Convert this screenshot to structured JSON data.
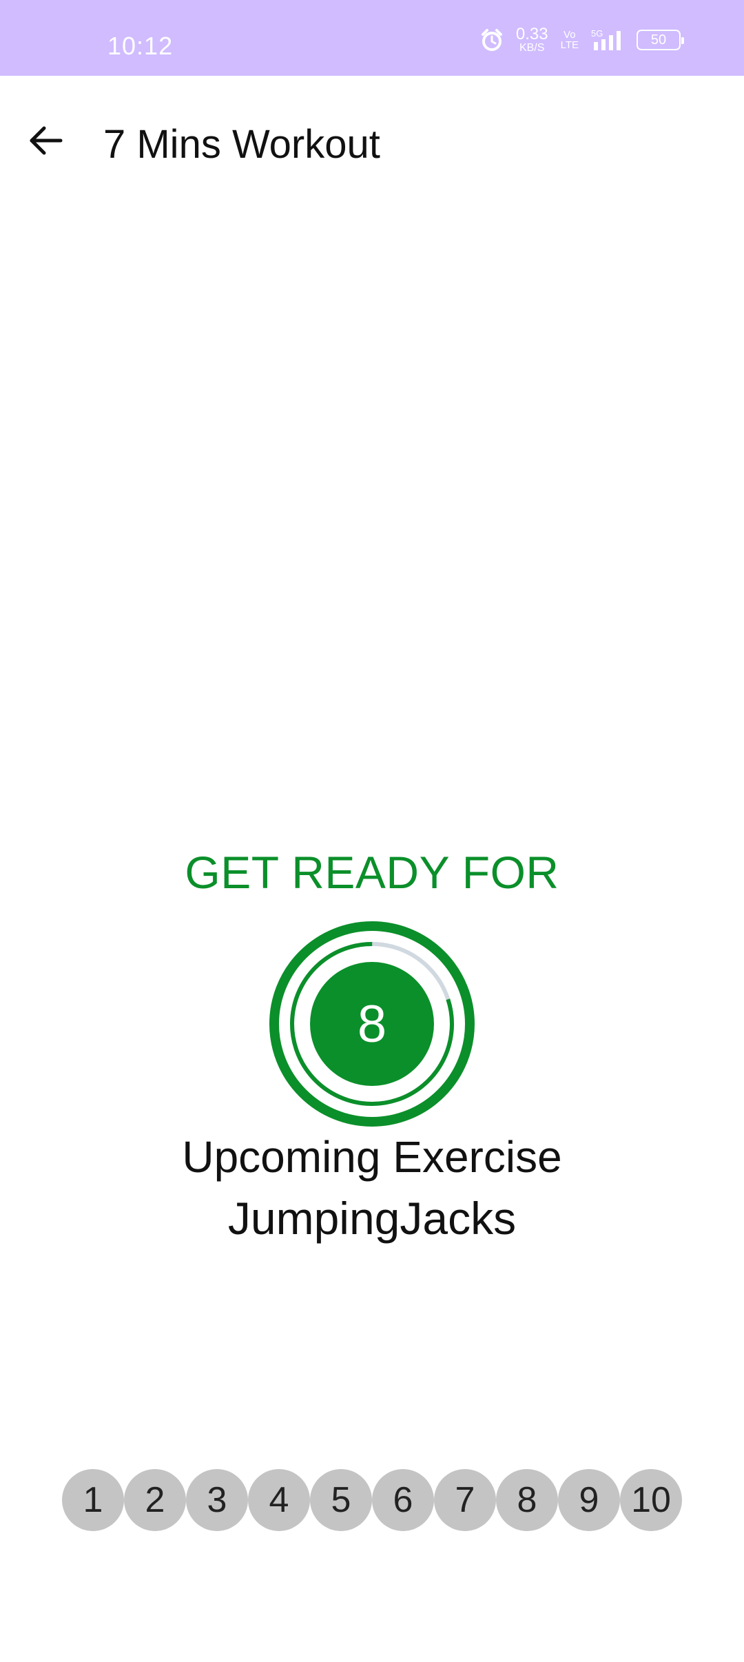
{
  "status_bar": {
    "time": "10:12",
    "net_speed": "0.33",
    "net_unit": "KB/S",
    "volte_top": "Vo",
    "volte_bottom": "LTE",
    "network": "5G",
    "battery": "50"
  },
  "app_bar": {
    "title": "7 Mins Workout"
  },
  "main": {
    "ready_label": "GET READY FOR",
    "timer_value": "8",
    "timer_progress": 0.8,
    "upcoming_label": "Upcoming Exercise",
    "exercise_name": "JumpingJacks"
  },
  "steps": [
    "1",
    "2",
    "3",
    "4",
    "5",
    "6",
    "7",
    "8",
    "9",
    "10"
  ],
  "colors": {
    "status_bar": "#d0bcff",
    "accent_green": "#0b8f2a",
    "track_grey": "#d0d8e0",
    "step_grey": "#c4c4c4"
  },
  "icons": {
    "back": "arrow-left-icon",
    "alarm": "alarm-icon",
    "signal": "signal-icon",
    "battery": "battery-icon"
  }
}
